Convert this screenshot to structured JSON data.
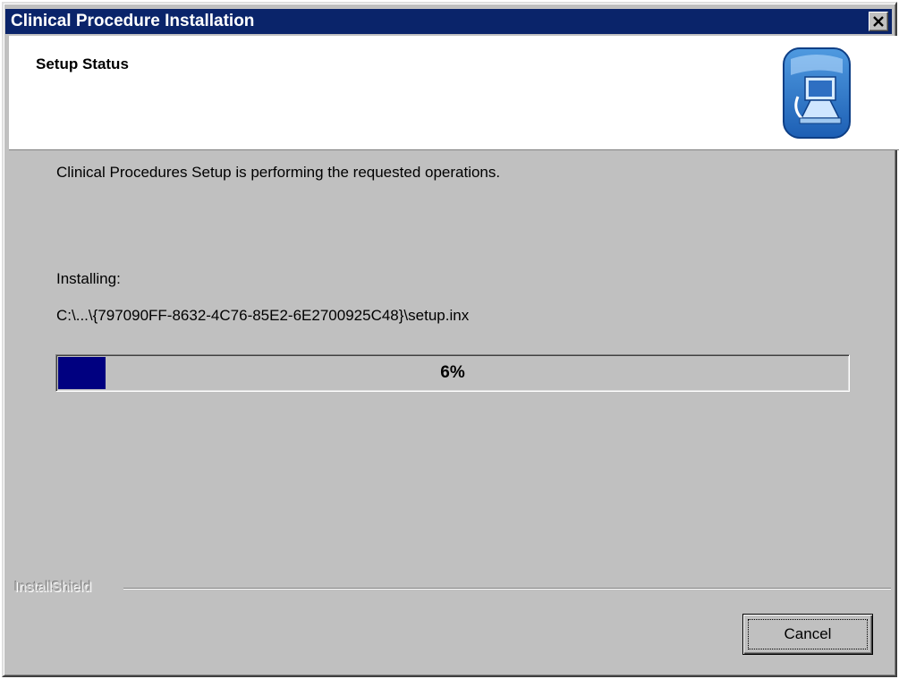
{
  "window": {
    "title": "Clinical Procedure Installation",
    "close_icon": "close-icon"
  },
  "header": {
    "title": "Setup Status",
    "logo_icon": "computer-setup-icon"
  },
  "body": {
    "status_text": "Clinical Procedures Setup is performing the requested operations.",
    "installing_label": "Installing:",
    "install_path": "C:\\...\\{797090FF-8632-4C76-85E2-6E2700925C48}\\setup.inx"
  },
  "progress": {
    "percent": 6,
    "label": "6%",
    "fill_color": "#000080"
  },
  "footer": {
    "brand": "InstallShield",
    "cancel_label": "Cancel"
  },
  "colors": {
    "title_bar": "#0a246a",
    "dialog_face": "#c0c0c0",
    "header_bg": "#ffffff"
  }
}
